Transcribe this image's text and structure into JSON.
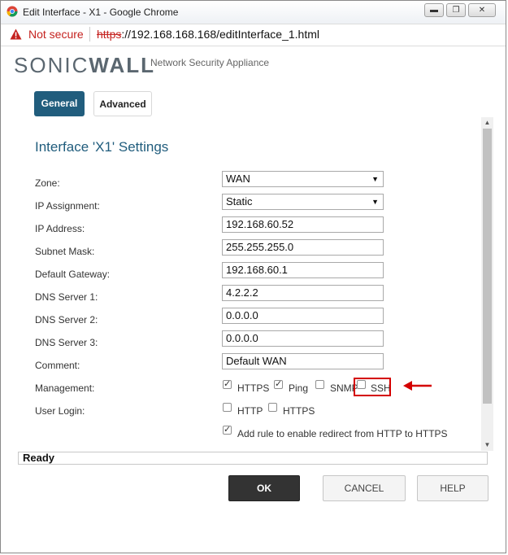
{
  "window": {
    "title": "Edit Interface - X1 - Google Chrome",
    "minimize_icon": "minimize-icon",
    "restore_icon": "restore-icon",
    "close_icon": "close-icon"
  },
  "addressbar": {
    "security_text": "Not secure",
    "url_scheme": "https",
    "url_rest": "://192.168.168.168/editInterface_1.html"
  },
  "brand": {
    "logo_part1": "SONIC",
    "logo_part2": "WALL",
    "subtitle": "Network Security Appliance"
  },
  "tabs": [
    {
      "label": "General",
      "active": true
    },
    {
      "label": "Advanced",
      "active": false
    }
  ],
  "section_title": "Interface 'X1' Settings",
  "form": {
    "zone": {
      "label": "Zone:",
      "value": "WAN"
    },
    "ip_assignment": {
      "label": "IP Assignment:",
      "value": "Static"
    },
    "ip_address": {
      "label": "IP Address:",
      "value": "192.168.60.52"
    },
    "subnet_mask": {
      "label": "Subnet Mask:",
      "value": "255.255.255.0"
    },
    "default_gateway": {
      "label": "Default Gateway:",
      "value": "192.168.60.1"
    },
    "dns1": {
      "label": "DNS Server 1:",
      "value": "4.2.2.2"
    },
    "dns2": {
      "label": "DNS Server 2:",
      "value": "0.0.0.0"
    },
    "dns3": {
      "label": "DNS Server 3:",
      "value": "0.0.0.0"
    },
    "comment": {
      "label": "Comment:",
      "value": "Default WAN"
    },
    "management": {
      "label": "Management:",
      "options": [
        {
          "label": "HTTPS",
          "checked": true
        },
        {
          "label": "Ping",
          "checked": true
        },
        {
          "label": "SNMP",
          "checked": false
        },
        {
          "label": "SSH",
          "checked": false
        }
      ]
    },
    "user_login": {
      "label": "User Login:",
      "options": [
        {
          "label": "HTTP",
          "checked": false
        },
        {
          "label": "HTTPS",
          "checked": false
        }
      ]
    },
    "redirect": {
      "label": "Add rule to enable redirect from HTTP to HTTPS",
      "checked": true
    }
  },
  "status": "Ready",
  "buttons": {
    "ok": "OK",
    "cancel": "CANCEL",
    "help": "HELP"
  },
  "colors": {
    "accent": "#215d7d",
    "annotation": "#d40000"
  }
}
